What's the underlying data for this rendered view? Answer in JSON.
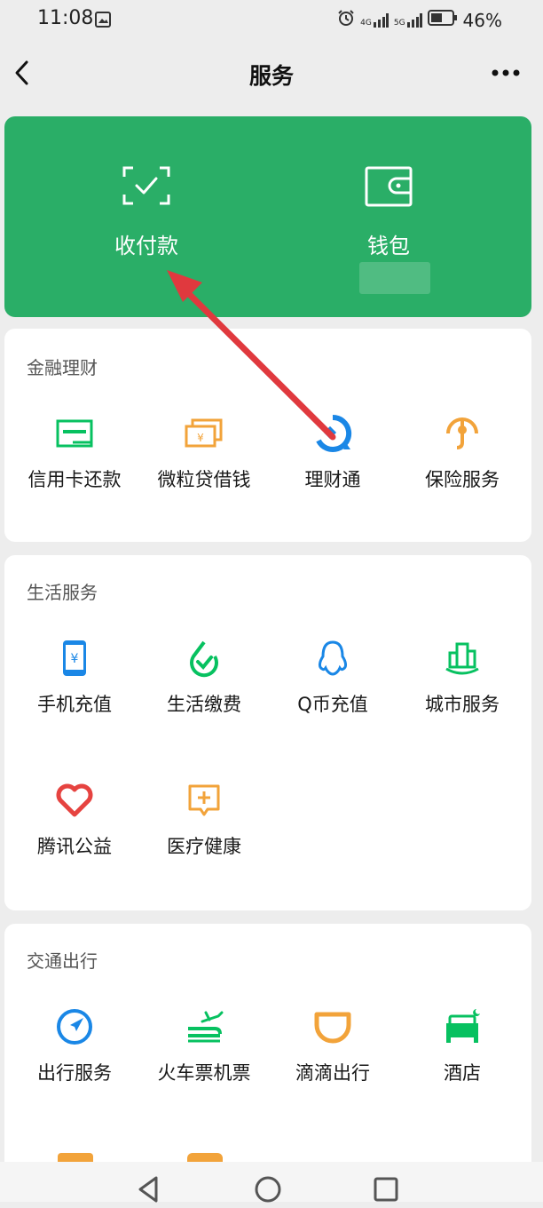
{
  "status": {
    "time": "11:08",
    "battery": "46%",
    "sig1": "4G",
    "sig2": "5G"
  },
  "nav": {
    "title": "服务"
  },
  "hero": {
    "items": [
      {
        "label": "收付款",
        "icon": "scan-pay-icon"
      },
      {
        "label": "钱包",
        "icon": "wallet-icon"
      }
    ]
  },
  "finance": {
    "title": "金融理财",
    "items": [
      {
        "label": "信用卡还款",
        "icon": "credit-card-icon",
        "color": "#07c160"
      },
      {
        "label": "微粒贷借钱",
        "icon": "loan-icon",
        "color": "#f2a33a"
      },
      {
        "label": "理财通",
        "icon": "licaitong-icon",
        "color": "#1a87e6"
      },
      {
        "label": "保险服务",
        "icon": "insurance-icon",
        "color": "#f2a33a"
      }
    ]
  },
  "life": {
    "title": "生活服务",
    "items": [
      {
        "label": "手机充值",
        "icon": "phone-recharge-icon",
        "color": "#1a87e6"
      },
      {
        "label": "生活缴费",
        "icon": "utility-pay-icon",
        "color": "#07c160"
      },
      {
        "label": "Q币充值",
        "icon": "qq-coin-icon",
        "color": "#1a87e6"
      },
      {
        "label": "城市服务",
        "icon": "city-service-icon",
        "color": "#07c160"
      },
      {
        "label": "腾讯公益",
        "icon": "charity-icon",
        "color": "#e64340"
      },
      {
        "label": "医疗健康",
        "icon": "medical-icon",
        "color": "#f2a33a"
      }
    ]
  },
  "travel": {
    "title": "交通出行",
    "items": [
      {
        "label": "出行服务",
        "icon": "travel-compass-icon",
        "color": "#1a87e6"
      },
      {
        "label": "火车票机票",
        "icon": "train-plane-icon",
        "color": "#07c160"
      },
      {
        "label": "滴滴出行",
        "icon": "didi-icon",
        "color": "#f2a33a"
      },
      {
        "label": "酒店",
        "icon": "hotel-icon",
        "color": "#07c160"
      }
    ]
  },
  "colors": {
    "hero_green": "#2aae67",
    "arrow": "#e0393e"
  }
}
